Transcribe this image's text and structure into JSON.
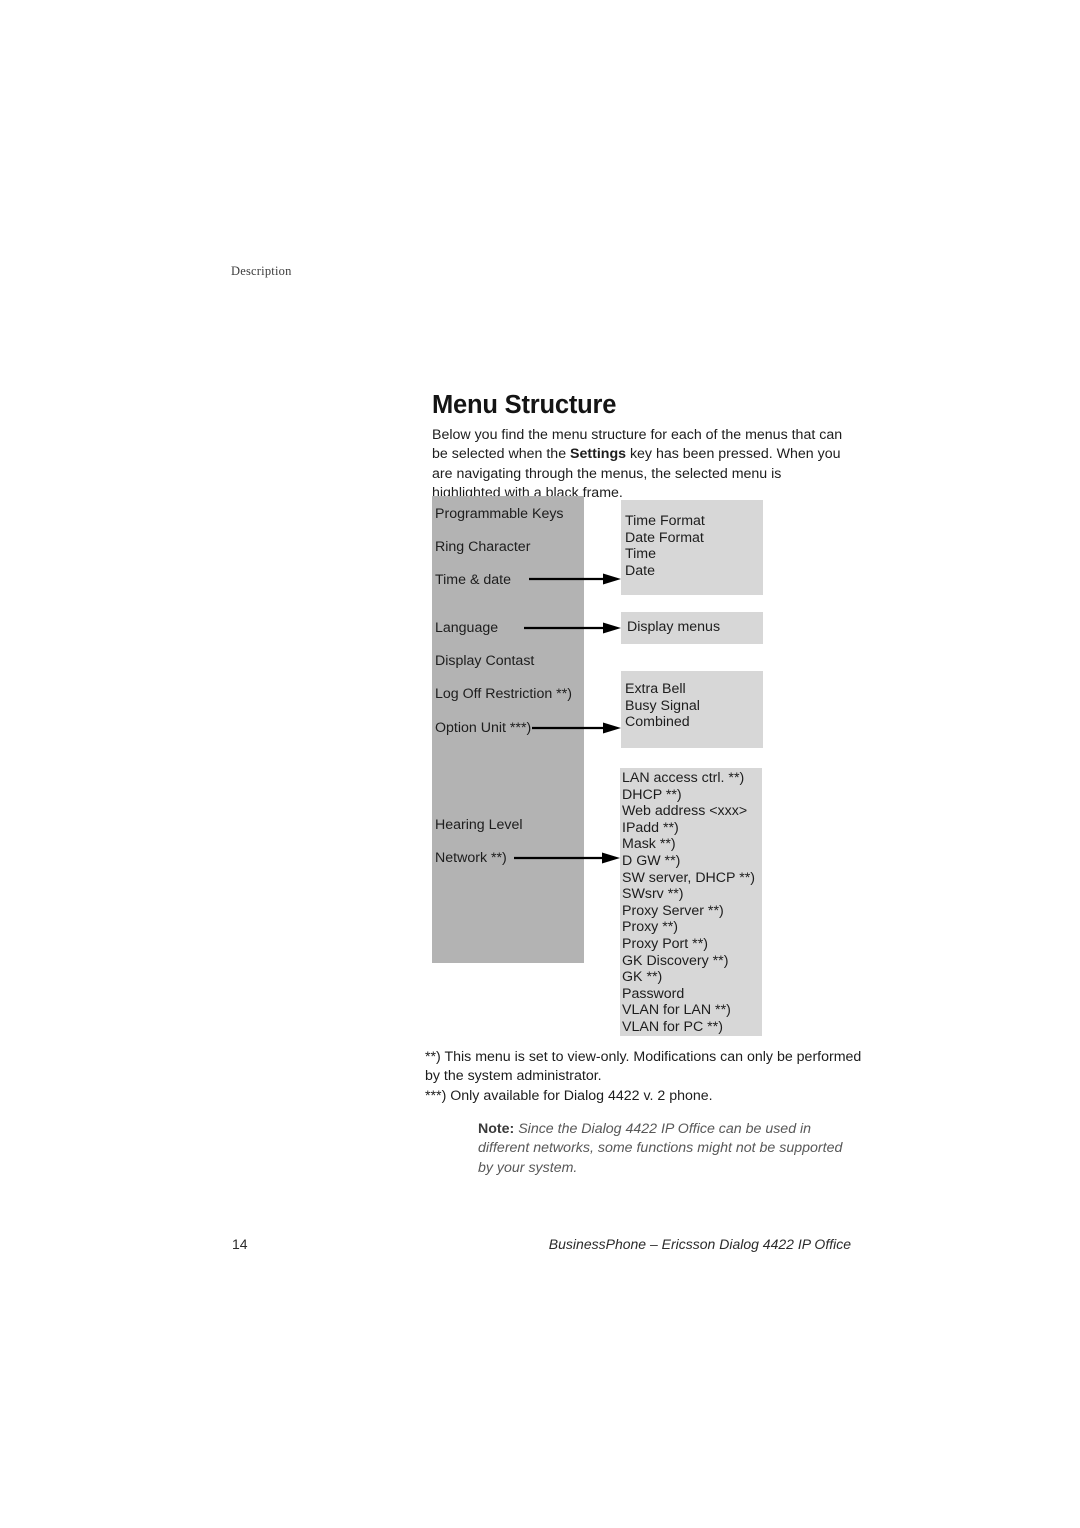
{
  "running_header": "Description",
  "title": "Menu Structure",
  "intro": {
    "part1": "Below you find the menu structure for each of the menus that can be selected when the ",
    "emphasis": "Settings",
    "part2": " key has been pressed. When you are navigating through the menus, the selected menu is highlighted with a black frame."
  },
  "diagram": {
    "main_menu": {
      "items": [
        "Programmable Keys",
        "Ring Character",
        "Time & date",
        "Language",
        "Display Contast",
        "Log Off Restriction **)",
        "Option Unit ***)",
        "Hearing Level",
        "Network **)"
      ]
    },
    "submenus": [
      {
        "parent": "Time & date",
        "items": [
          "Time Format",
          "Date Format",
          "Time",
          "Date"
        ]
      },
      {
        "parent": "Language",
        "items": [
          "Display menus"
        ]
      },
      {
        "parent": "Option Unit ***)",
        "items": [
          "Extra Bell",
          "Busy Signal",
          "Combined"
        ]
      },
      {
        "parent": "Network **)",
        "items": [
          "LAN access ctrl. **)",
          "DHCP **)",
          "Web address <xxx>",
          "IPadd **)",
          "Mask **)",
          "D GW **)",
          "SW server,  DHCP **)",
          "SWsrv **)",
          "Proxy Server **)",
          "Proxy **)",
          "Proxy Port **)",
          "GK Discovery **)",
          "GK **)",
          "Password",
          "VLAN for LAN **)",
          "VLAN for PC **)"
        ]
      }
    ],
    "colors": {
      "main_menu_fill": "#b3b3b3",
      "submenu_fill": "#d7d7d7",
      "arrow": "#000000"
    }
  },
  "footnotes": {
    "double_star": "**) This menu is set to view-only. Modifications can only be performed by the system administrator.",
    "triple_star": "***) Only available for Dialog 4422 v. 2 phone."
  },
  "note": {
    "label": "Note:",
    "text": " Since the Dialog 4422 IP Office can be used in different networks, some functions might not be supported by your system."
  },
  "footer": {
    "page_number": "14",
    "document_title": "BusinessPhone – Ericsson Dialog 4422 IP Office"
  }
}
